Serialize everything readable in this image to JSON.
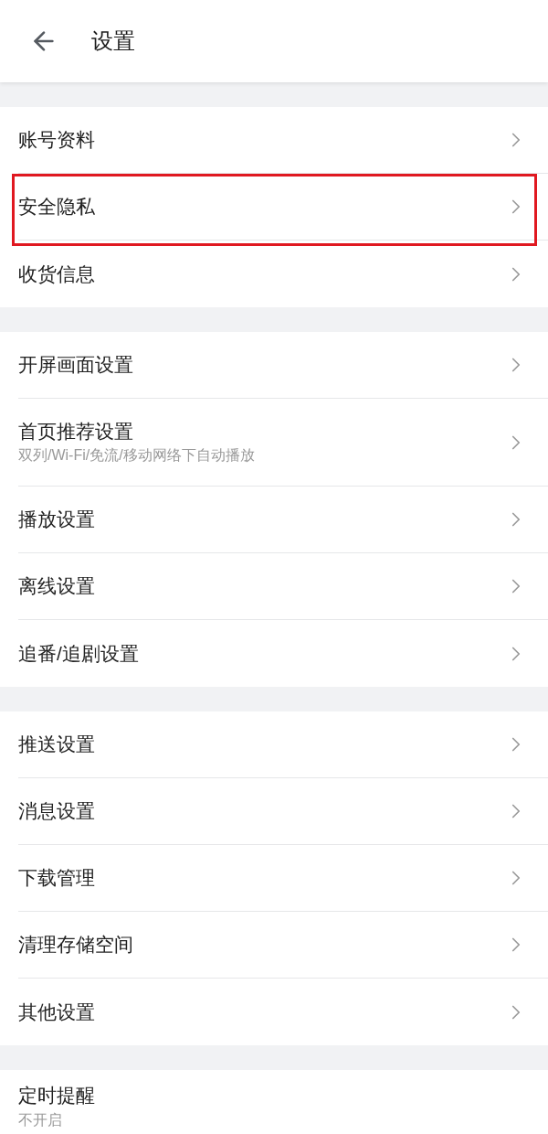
{
  "header": {
    "title": "设置"
  },
  "sections": [
    {
      "items": [
        {
          "kind": "nav",
          "label": "账号资料",
          "highlighted": false
        },
        {
          "kind": "nav",
          "label": "安全隐私",
          "highlighted": true
        },
        {
          "kind": "nav",
          "label": "收货信息",
          "highlighted": false
        }
      ]
    },
    {
      "items": [
        {
          "kind": "nav",
          "label": "开屏画面设置",
          "highlighted": false
        },
        {
          "kind": "nav",
          "label": "首页推荐设置",
          "subtitle": "双列/Wi-Fi/免流/移动网络下自动播放",
          "highlighted": false
        },
        {
          "kind": "nav",
          "label": "播放设置",
          "highlighted": false
        },
        {
          "kind": "nav",
          "label": "离线设置",
          "highlighted": false
        },
        {
          "kind": "nav",
          "label": "追番/追剧设置",
          "highlighted": false
        }
      ]
    },
    {
      "items": [
        {
          "kind": "nav",
          "label": "推送设置",
          "highlighted": false
        },
        {
          "kind": "nav",
          "label": "消息设置",
          "highlighted": false
        },
        {
          "kind": "nav",
          "label": "下载管理",
          "highlighted": false
        },
        {
          "kind": "nav",
          "label": "清理存储空间",
          "highlighted": false
        },
        {
          "kind": "nav",
          "label": "其他设置",
          "highlighted": false
        }
      ]
    },
    {
      "items": [
        {
          "kind": "text",
          "label": "定时提醒",
          "subtitle": "不开启",
          "highlighted": false
        }
      ]
    }
  ]
}
